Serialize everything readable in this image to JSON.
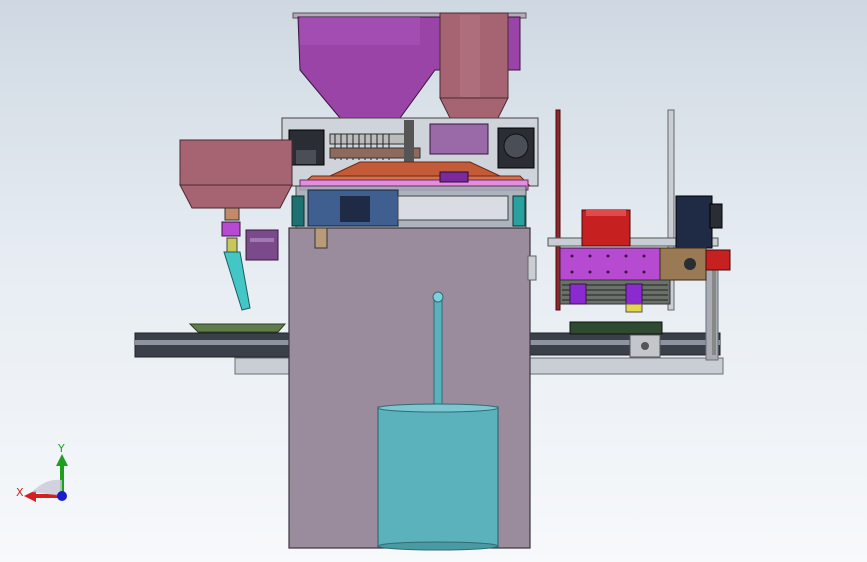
{
  "viewport": {
    "background_top": "#cfd8e2",
    "background_bottom": "#f7f9fb"
  },
  "colors": {
    "cabinet": "#9a8c9c",
    "hopper_purple": "#9a44a8",
    "hopper_rose": "#a66472",
    "bowl_rose": "#a66472",
    "water_tank": "#5bb2bd",
    "feeder_purple": "#b64ad0",
    "motor_red": "#c62020",
    "motor_navy": "#1f2a44",
    "frame_grey": "#a9adb3",
    "conveyor_dark": "#3a3f4a",
    "nozzle_cyan": "#43c7c6"
  },
  "triad": {
    "x_label": "X",
    "y_label": "Y",
    "x_color": "#d22020",
    "y_color": "#1ea01e",
    "z_color": "#1a1ad0"
  }
}
